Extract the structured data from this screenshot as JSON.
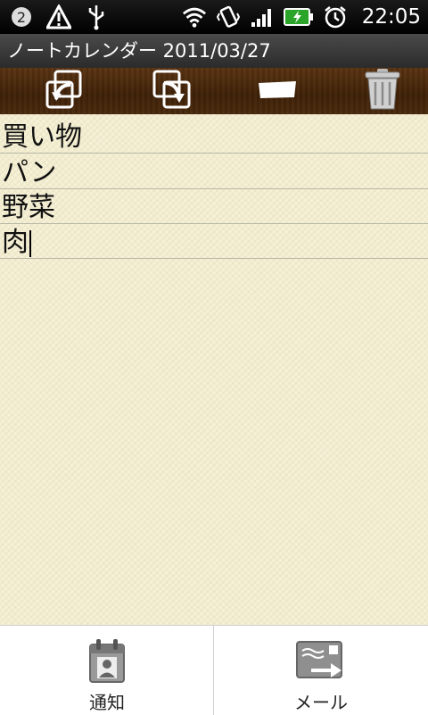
{
  "status_bar": {
    "time": "22:05",
    "icons": [
      "notification-app-icon",
      "warning-icon",
      "usb-icon",
      "wifi-icon",
      "vibrate-icon",
      "signal-icon",
      "battery-charging-icon",
      "alarm-icon"
    ]
  },
  "title_bar": {
    "title": "ノートカレンダー 2011/03/27"
  },
  "toolbar": {
    "icons": [
      "undo-icon",
      "redo-icon",
      "eraser-icon",
      "trash-icon"
    ]
  },
  "note": {
    "lines": [
      "買い物",
      "パン",
      "野菜",
      "肉"
    ]
  },
  "bottom_menu": {
    "items": [
      {
        "label": "通知",
        "icon": "calendar-contact-icon"
      },
      {
        "label": "メール",
        "icon": "mail-send-icon"
      }
    ]
  },
  "colors": {
    "toolbar_brown": "#4a2a0d",
    "paper": "#f6f1d6",
    "titlebar": "#3a3a3a"
  }
}
